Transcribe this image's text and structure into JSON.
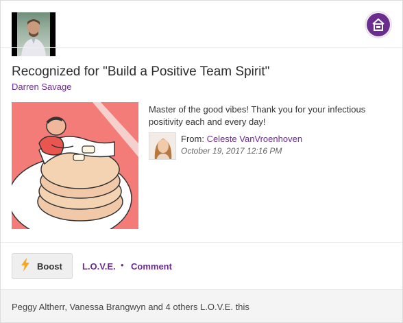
{
  "recognition": {
    "title": "Recognized for \"Build a Positive Team Spirit\"",
    "recipient_name": "Darren Savage",
    "message_line1": "Master of the good vibes! Thank you for your infectious",
    "message_line2": "positivity each and every day!",
    "from_label": "From: ",
    "from_name": "Celeste VanVroenhoven",
    "date": "October 19, 2017 12:16 PM"
  },
  "actions": {
    "boost_label": "Boost",
    "love_label": "L.O.V.E.",
    "separator": "•",
    "comment_label": "Comment"
  },
  "footer": {
    "likes_text": "Peggy Altherr, Vanessa Brangwyn and 4 others L.O.V.E. this"
  },
  "icons": {
    "badge": "house-badge-icon",
    "boost": "lightning-bolt-icon"
  },
  "colors": {
    "accent": "#6b2d8e",
    "bolt": "#f5a623",
    "illustration_bg": "#f47c78",
    "footer_bg": "#f4f4f4"
  }
}
